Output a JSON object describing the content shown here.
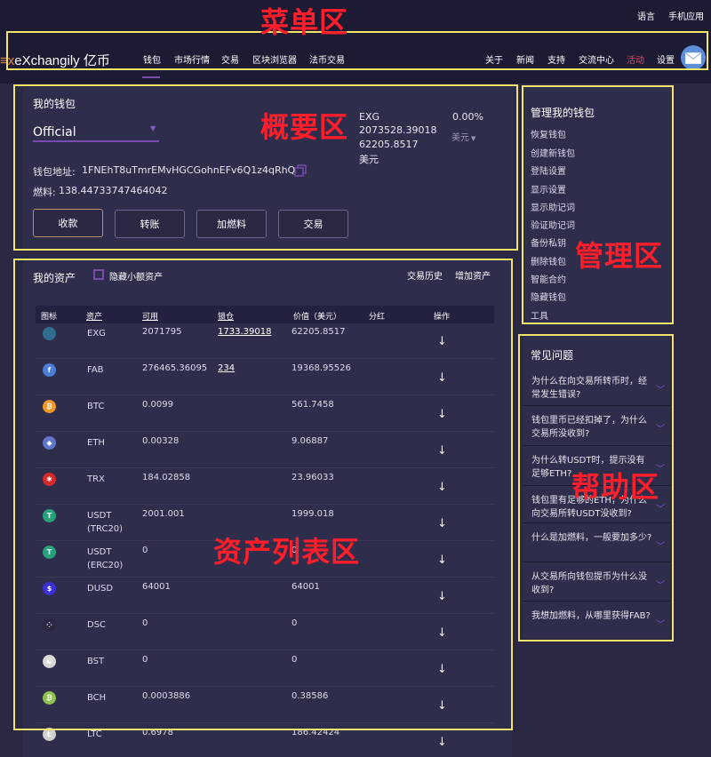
{
  "topbar": {
    "language": "语言",
    "mobile_app": "手机应用"
  },
  "brand": {
    "prefix": "≡x",
    "name": "eXchangily 亿币"
  },
  "nav_left": [
    "钱包",
    "市场行情",
    "交易",
    "区块浏览器",
    "法币交易"
  ],
  "nav_right": [
    "关于",
    "新闻",
    "支持",
    "交流中心",
    "活动",
    "设置"
  ],
  "annotations": {
    "menu": "菜单区",
    "summary": "概要区",
    "manage": "管理区",
    "help": "帮助区",
    "assets": "资产列表区"
  },
  "wallet": {
    "title": "我的钱包",
    "selected_wallet": "Official",
    "coin": "EXG",
    "coin_amount": "2073528.39018",
    "coin_value": "62205.8517",
    "currency": "美元",
    "change": "0.00%",
    "currency_select": "美元",
    "address_label": "钱包地址:",
    "address": "1FNEhT8uTmrEMvHGCGohnEFv6Q1z4qRhQu",
    "gas_label": "燃料:",
    "gas_value": "138.44733747464042",
    "buttons": {
      "receive": "收款",
      "send": "转账",
      "add_gas": "加燃料",
      "trade": "交易"
    }
  },
  "manage": {
    "title": "管理我的钱包",
    "items": [
      "恢复钱包",
      "创建新钱包",
      "登陆设置",
      "显示设置",
      "显示助记词",
      "验证助记词",
      "备份私钥",
      "删除钱包",
      "智能合约",
      "隐藏钱包",
      "工具"
    ]
  },
  "faq": {
    "title": "常见问题",
    "items": [
      "为什么在向交易所转币时，经常发生错误?",
      "钱包里币已经扣掉了，为什么交易所没收到?",
      "为什么转USDT时，提示没有足够ETH?",
      "钱包里有足够的ETH，为什么向交易所转USDT没收到?",
      "什么是加燃料，一般要加多少?",
      "从交易所向钱包提币为什么没收到?",
      "我想加燃料，从哪里获得FAB?"
    ]
  },
  "assets": {
    "title": "我的资产",
    "hide_small": "隐藏小额资产",
    "history": "交易历史",
    "add": "增加资产",
    "headers": {
      "icon": "图标",
      "asset": "资产",
      "available": "可用",
      "locked": "锁仓",
      "value": "价值（美元）",
      "dividend": "分红",
      "action": "操作"
    },
    "rows": [
      {
        "symbol": "EXG",
        "available": "2071795",
        "locked": "1733.39018",
        "value": "62205.8517",
        "icon_color": "#2f6d8f",
        "glyph": ""
      },
      {
        "symbol": "FAB",
        "available": "276465.36095",
        "locked": "234",
        "value": "19368.95526",
        "icon_color": "#4f7ed8",
        "glyph": "f"
      },
      {
        "symbol": "BTC",
        "available": "0.0099",
        "locked": "",
        "value": "561.7458",
        "icon_color": "#f29628",
        "glyph": "₿"
      },
      {
        "symbol": "ETH",
        "available": "0.00328",
        "locked": "",
        "value": "9.06887",
        "icon_color": "#6276c9",
        "glyph": "◆"
      },
      {
        "symbol": "TRX",
        "available": "184.02858",
        "locked": "",
        "value": "23.96033",
        "icon_color": "#d52a2a",
        "glyph": "✱"
      },
      {
        "symbol": "USDT\n(TRC20)",
        "available": "2001.001",
        "locked": "",
        "value": "1999.018",
        "icon_color": "#26a17b",
        "glyph": "T"
      },
      {
        "symbol": "USDT\n(ERC20)",
        "available": "0",
        "locked": "",
        "value": "0",
        "icon_color": "#26a17b",
        "glyph": "T"
      },
      {
        "symbol": "DUSD",
        "available": "64001",
        "locked": "",
        "value": "64001",
        "icon_color": "#3b2fd6",
        "glyph": "$"
      },
      {
        "symbol": "DSC",
        "available": "0",
        "locked": "",
        "value": "0",
        "icon_color": "#2a2843",
        "glyph": "⁘"
      },
      {
        "symbol": "BST",
        "available": "0",
        "locked": "",
        "value": "0",
        "icon_color": "#d8d8d8",
        "glyph": "☯"
      },
      {
        "symbol": "BCH",
        "available": "0.0003886",
        "locked": "",
        "value": "0.38586",
        "icon_color": "#8dc351",
        "glyph": "₿"
      },
      {
        "symbol": "LTC",
        "available": "0.6978",
        "locked": "",
        "value": "186.42424",
        "icon_color": "#cfcfcf",
        "glyph": "Ł"
      }
    ]
  }
}
